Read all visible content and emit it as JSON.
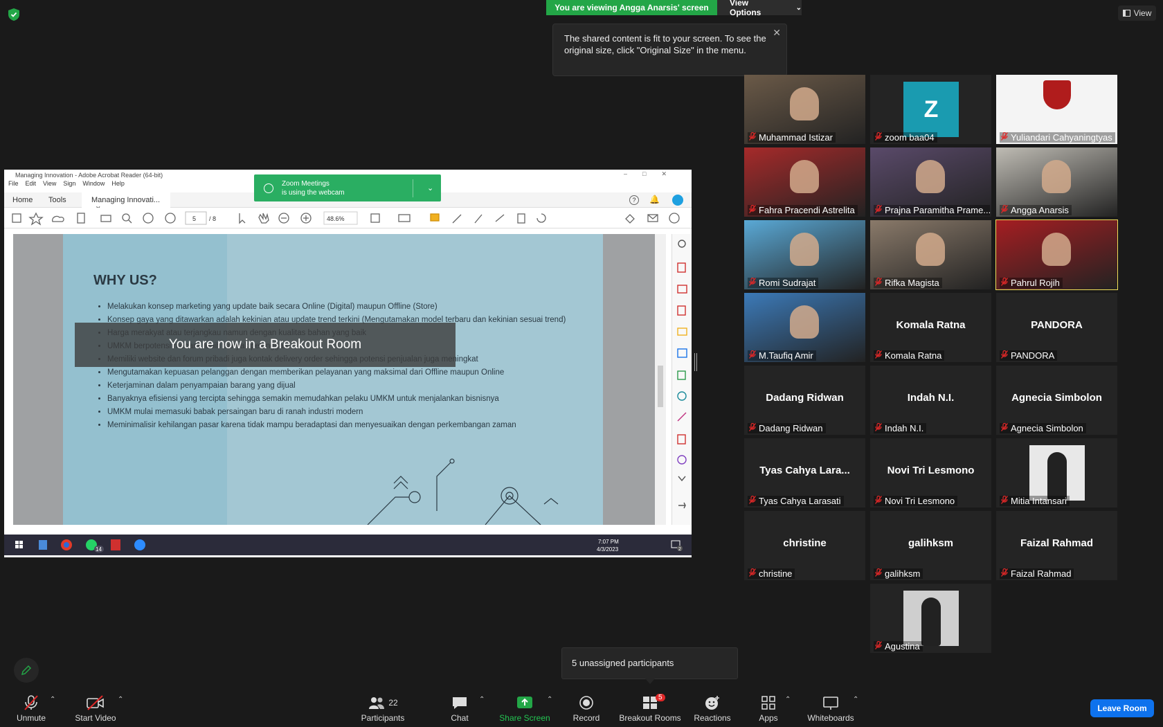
{
  "banner": {
    "viewing_text": "You are viewing Angga Anarsis' screen",
    "view_options_label": "View Options",
    "view_label": "View"
  },
  "tooltip": {
    "text": "The shared content is fit to your screen. To see the original size, click \"Original Size\" in the menu."
  },
  "shared_screen": {
    "window_title": "Managing Innovation - Adobe Acrobat Reader (64-bit)",
    "menu": [
      "File",
      "Edit",
      "View",
      "Sign",
      "Window",
      "Help"
    ],
    "tabs": {
      "home": "Home",
      "tools": "Tools",
      "doc": "Managing Innovati..."
    },
    "page_current": "5",
    "page_total": "/ 8",
    "zoom_level": "48.6%",
    "zoom_notice": {
      "line1": "Zoom Meetings",
      "line2": "is using the webcam"
    },
    "slide": {
      "title": "WHY US?",
      "bullets": [
        "Melakukan konsep marketing yang update baik secara Online (Digital) maupun Offline (Store)",
        "Konsep gaya yang ditawarkan adalah kekinian atau update trend terkini (Mengutamakan model terbaru dan kekinian sesuai trend)",
        "Harga merakyat atau terjangkau namun dengan kualitas bahan yang baik",
        "UMKM berpotensi menarik lebih banyak pelanggan",
        "Memiliki website dan forum pribadi juga kontak delivery order sehingga potensi penjualan juga meningkat",
        "Mengutamakan kepuasan pelanggan dengan memberikan pelayanan yang maksimal dari Offline maupun Online",
        "Keterjaminan dalam penyampaian barang yang dijual",
        "Banyaknya efisiensi yang tercipta sehingga semakin memudahkan pelaku UMKM untuk menjalankan bisnisnya",
        "UMKM mulai memasuki babak persaingan baru di ranah industri modern",
        "Meminimalisir kehilangan pasar karena tidak mampu beradaptasi dan menyesuaikan dengan perkembangan zaman"
      ]
    },
    "breakout_overlay": "You are now in a Breakout Room",
    "taskbar": {
      "time": "7:07 PM",
      "date": "4/3/2023",
      "whatsapp_badge": "14",
      "notif_badge": "2"
    }
  },
  "participants_gallery": [
    {
      "name": "Muhammad Istizar",
      "big": "",
      "kind": "video",
      "color": "#6b5a48"
    },
    {
      "name": "zoom baa04",
      "big": "",
      "kind": "letter",
      "letter": "Z",
      "color": "#1a9bb0"
    },
    {
      "name": "Yuliandari Cahyaningtyas",
      "big": "",
      "kind": "logo",
      "color": "#f4f4f4"
    },
    {
      "name": "Fahra Pracendi Astrelita",
      "big": "",
      "kind": "video",
      "color": "#a62a2a"
    },
    {
      "name": "Prajna Paramitha Prame...",
      "big": "",
      "kind": "video",
      "color": "#5a4a6a"
    },
    {
      "name": "Angga Anarsis",
      "big": "",
      "kind": "video",
      "color": "#bfbcb4"
    },
    {
      "name": "Romi Sudrajat",
      "big": "",
      "kind": "video",
      "color": "#5aa9d6"
    },
    {
      "name": "Rifka Magista",
      "big": "",
      "kind": "video",
      "color": "#8a7a6a"
    },
    {
      "name": "Pahrul Rojih",
      "big": "",
      "kind": "video",
      "color": "#a51e22",
      "active": true
    },
    {
      "name": "M.Taufiq Amir",
      "big": "",
      "kind": "video",
      "color": "#3c7ab8"
    },
    {
      "name": "Komala Ratna",
      "big": "Komala Ratna",
      "kind": "name"
    },
    {
      "name": "PANDORA",
      "big": "PANDORA",
      "kind": "name"
    },
    {
      "name": "Dadang Ridwan",
      "big": "Dadang Ridwan",
      "kind": "name"
    },
    {
      "name": "Indah N.I.",
      "big": "Indah N.I.",
      "kind": "name"
    },
    {
      "name": "Agnecia Simbolon",
      "big": "Agnecia Simbolon",
      "kind": "name"
    },
    {
      "name": "Tyas Cahya Larasati",
      "big": "Tyas Cahya Lara...",
      "kind": "name"
    },
    {
      "name": "Novi Tri Lesmono",
      "big": "Novi Tri Lesmono",
      "kind": "name"
    },
    {
      "name": "Mitia Intansari",
      "big": "",
      "kind": "photo",
      "color": "#e8e8e8"
    },
    {
      "name": "christine",
      "big": "christine",
      "kind": "name"
    },
    {
      "name": "galihksm",
      "big": "galihksm",
      "kind": "name"
    },
    {
      "name": "Faizal Rahmad",
      "big": "Faizal Rahmad",
      "kind": "name"
    },
    {
      "name": "Agustina",
      "big": "",
      "kind": "photo",
      "color": "#cfcfcf"
    }
  ],
  "unassigned_popup": "5 unassigned participants",
  "toolbar": {
    "unmute": "Unmute",
    "start_video": "Start Video",
    "participants": "Participants",
    "participants_count": "22",
    "chat": "Chat",
    "share_screen": "Share Screen",
    "record": "Record",
    "breakout_rooms": "Breakout Rooms",
    "breakout_badge": "5",
    "reactions": "Reactions",
    "apps": "Apps",
    "whiteboards": "Whiteboards",
    "leave": "Leave Room"
  },
  "colors": {
    "share_green": "#23a647",
    "leave_blue": "#0e72ed",
    "active_speaker": "#f0e05a",
    "mic_off_red": "#e02828"
  }
}
